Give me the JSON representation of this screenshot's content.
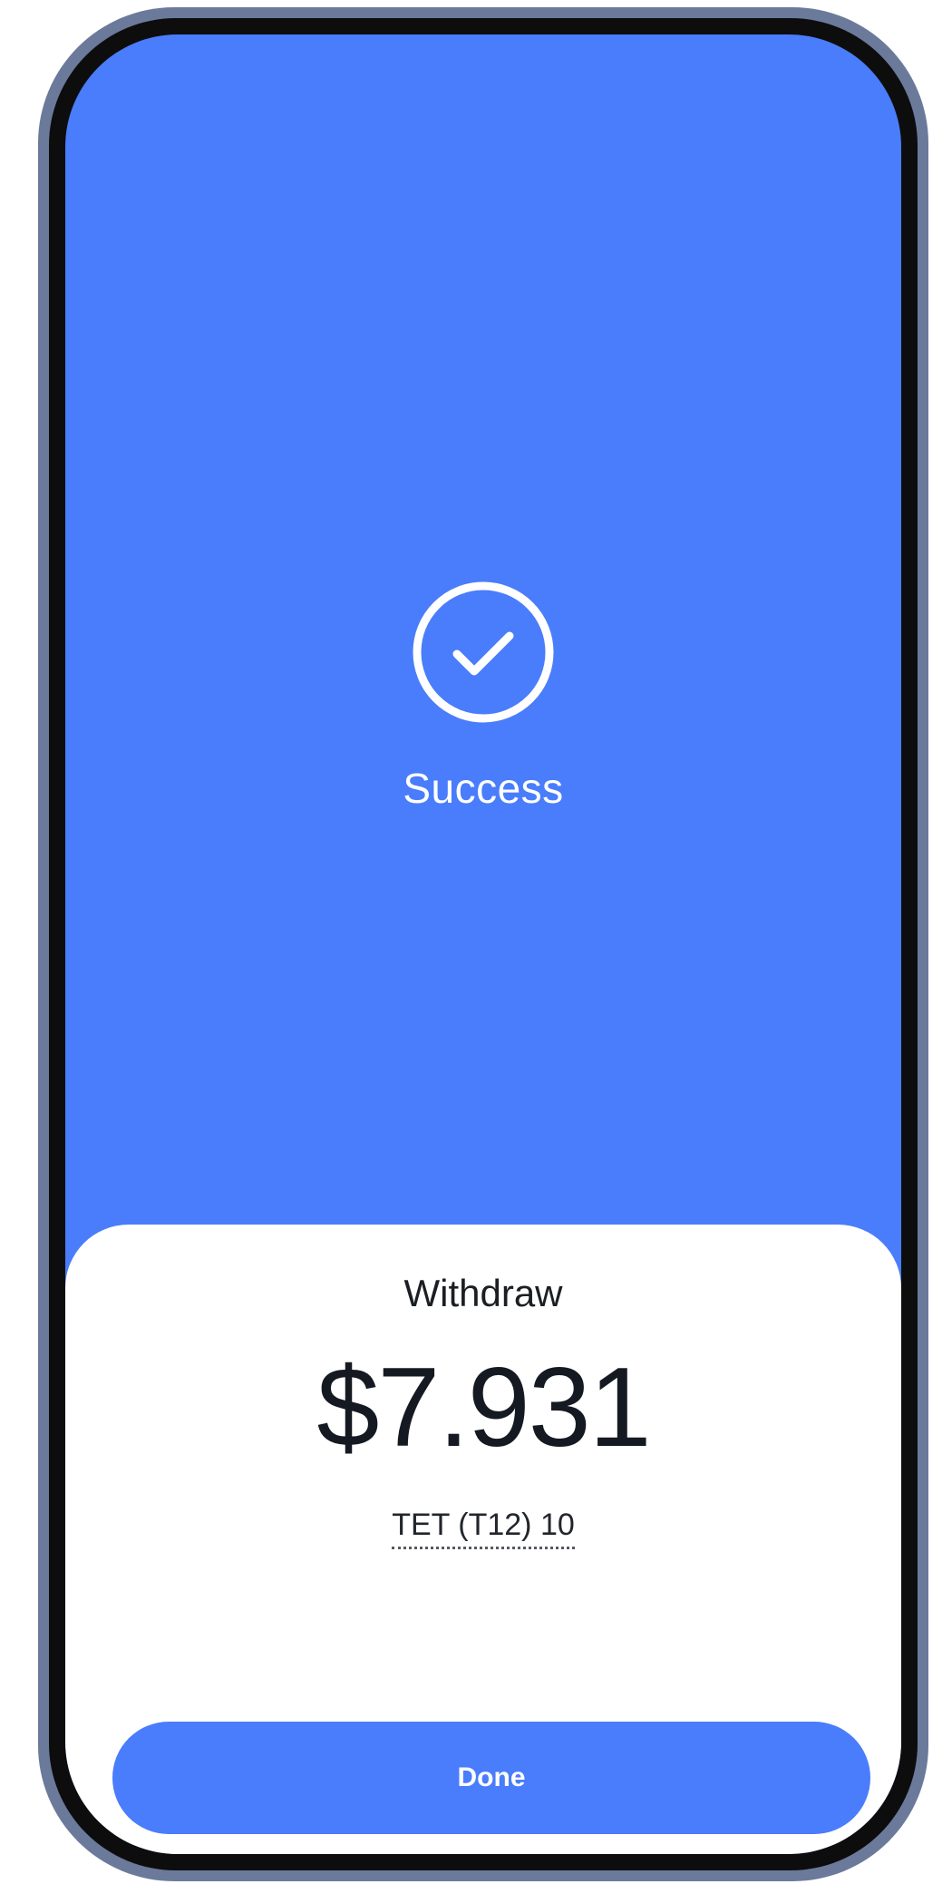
{
  "theme": {
    "accent": "#4a7dfb",
    "frame": "#6b7a9b",
    "bezel": "#0d0d0e",
    "sheet_bg": "#ffffff"
  },
  "status": {
    "icon": "check-circle-icon",
    "title": "Success"
  },
  "transaction": {
    "type_label": "Withdraw",
    "amount": "$7.931",
    "ticker": "TET (T12) 10"
  },
  "actions": {
    "done_label": "Done"
  }
}
